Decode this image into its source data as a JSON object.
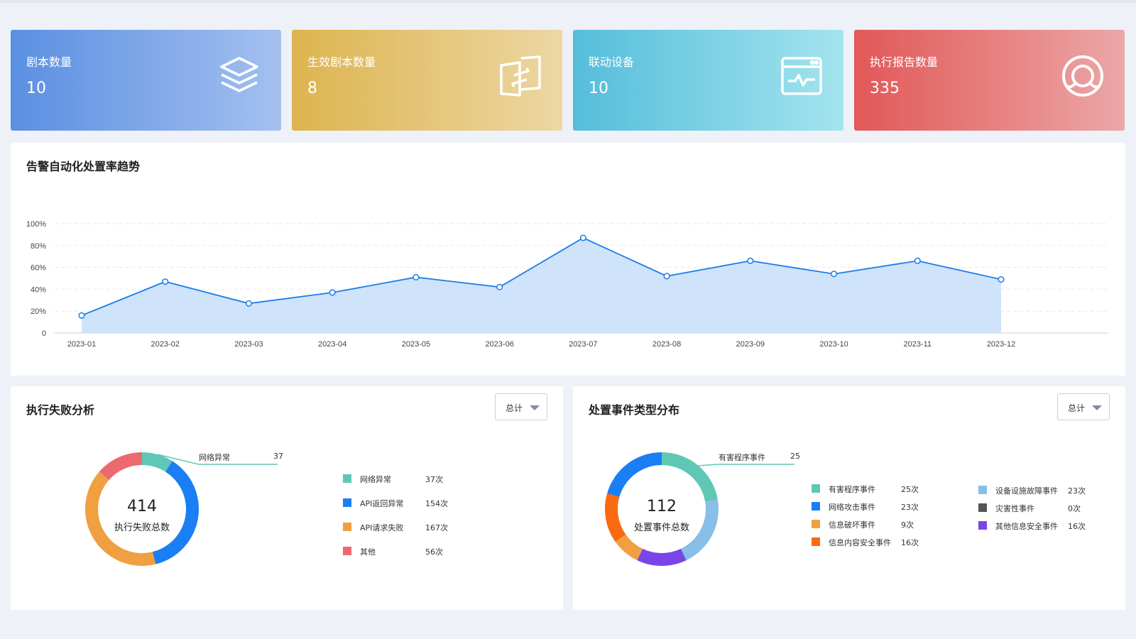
{
  "stats": [
    {
      "label": "剧本数量",
      "value": "10",
      "icon": "layers-icon"
    },
    {
      "label": "生效剧本数量",
      "value": "8",
      "icon": "switch-arrow-icon"
    },
    {
      "label": "联动设备",
      "value": "10",
      "icon": "monitor-pulse-icon"
    },
    {
      "label": "执行报告数量",
      "value": "335",
      "icon": "report-bubble-icon"
    }
  ],
  "trend": {
    "title": "告警自动化处置率趋势",
    "chart_data": {
      "type": "area",
      "categories": [
        "2023-01",
        "2023-02",
        "2023-03",
        "2023-04",
        "2023-05",
        "2023-06",
        "2023-07",
        "2023-08",
        "2023-09",
        "2023-10",
        "2023-11",
        "2023-12"
      ],
      "values": [
        16,
        47,
        27,
        37,
        51,
        42,
        87,
        52,
        66,
        54,
        66,
        49
      ],
      "ylim": [
        0,
        100
      ],
      "yticks": [
        "0",
        "20%",
        "40%",
        "60%",
        "80%",
        "100%"
      ],
      "grid": true,
      "color": "#1a7ee8",
      "fill": "#cfe3fb"
    }
  },
  "fail": {
    "title": "执行失败分析",
    "select": "总计",
    "total": "414",
    "total_label": "执行失败总数",
    "callout": {
      "name": "网络异常",
      "value": "37"
    },
    "chart_data": {
      "type": "pie",
      "categories": [
        "网络异常",
        "API返回异常",
        "API请求失败",
        "其他"
      ],
      "values": [
        37,
        154,
        167,
        56
      ],
      "colors": [
        "#5ec8b5",
        "#1a7ef5",
        "#f0a040",
        "#ec6a6f"
      ]
    },
    "legend": [
      {
        "name": "网络异常",
        "count": "37次",
        "color": "#5ec8b5"
      },
      {
        "name": "API返回异常",
        "count": "154次",
        "color": "#1a7ef5"
      },
      {
        "name": "API请求失败",
        "count": "167次",
        "color": "#f0a040"
      },
      {
        "name": "其他",
        "count": "56次",
        "color": "#ec6a6f"
      }
    ]
  },
  "dist": {
    "title": "处置事件类型分布",
    "select": "总计",
    "total": "112",
    "total_label": "处置事件总数",
    "callout": {
      "name": "有害程序事件",
      "value": "25"
    },
    "chart_data": {
      "type": "pie",
      "categories": [
        "有害程序事件",
        "设备设施故障事件",
        "其他信息安全事件",
        "信息破坏事件",
        "信息内容安全事件",
        "网络攻击事件",
        "灾害性事件"
      ],
      "values": [
        25,
        23,
        16,
        9,
        16,
        23,
        0
      ],
      "colors": [
        "#5ec8b5",
        "#88bfe8",
        "#7a45e8",
        "#f0a040",
        "#fa6a10",
        "#1a7ef5",
        "#555555"
      ]
    },
    "legend_left": [
      {
        "name": "有害程序事件",
        "count": "25次",
        "color": "#5ec8b5"
      },
      {
        "name": "网络攻击事件",
        "count": "23次",
        "color": "#1a7ef5"
      },
      {
        "name": "信息破坏事件",
        "count": "9次",
        "color": "#f0a040"
      },
      {
        "name": "信息内容安全事件",
        "count": "16次",
        "color": "#fa6a10"
      }
    ],
    "legend_right": [
      {
        "name": "设备设施故障事件",
        "count": "23次",
        "color": "#88bfe8"
      },
      {
        "name": "灾害性事件",
        "count": "0次",
        "color": "#555555"
      },
      {
        "name": "其他信息安全事件",
        "count": "16次",
        "color": "#7a45e8"
      }
    ]
  }
}
